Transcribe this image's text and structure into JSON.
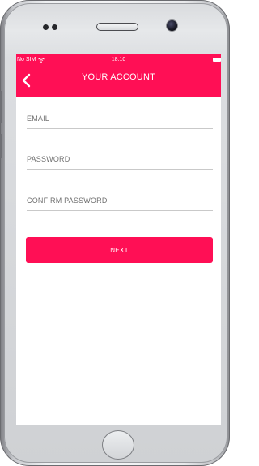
{
  "statusbar": {
    "carrier": "No SIM",
    "time": "18:10",
    "icons": [
      "wifi-icon",
      "battery-icon"
    ]
  },
  "navbar": {
    "title": "YOUR ACCOUNT",
    "back_icon": "chevron-left-icon"
  },
  "form": {
    "email": {
      "value": "",
      "placeholder": "EMAIL"
    },
    "password": {
      "value": "",
      "placeholder": "PASSWORD"
    },
    "confirm_password": {
      "value": "",
      "placeholder": "CONFIRM PASSWORD"
    }
  },
  "actions": {
    "next_label": "NEXT"
  },
  "colors": {
    "accent": "#ff0f55",
    "background": "#ffffff",
    "divider": "#c9c9c9"
  }
}
